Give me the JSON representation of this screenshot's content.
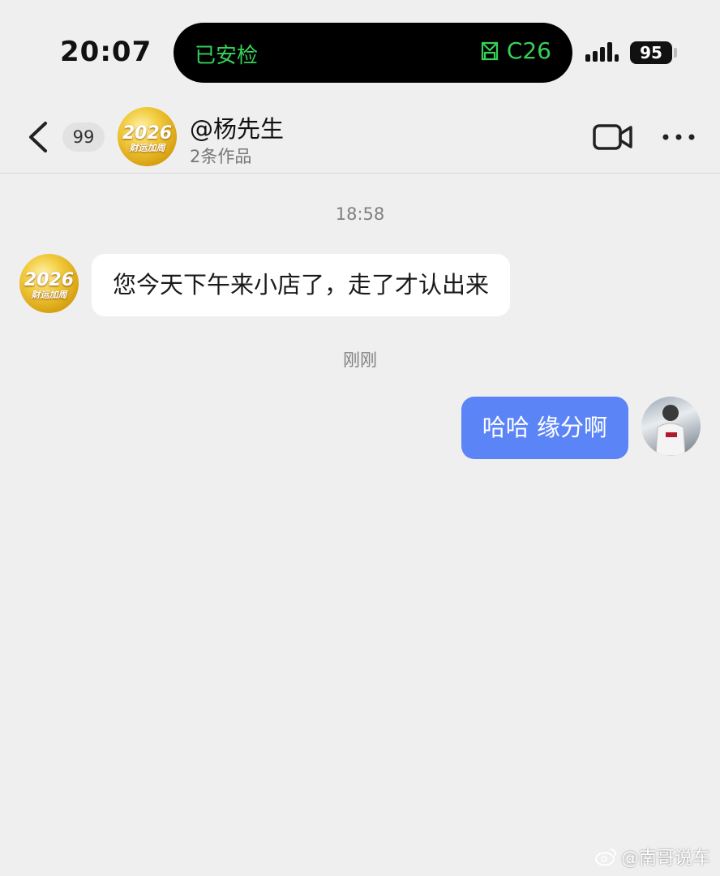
{
  "status_bar": {
    "time": "20:07",
    "island_left": "已安检",
    "island_right": "C26",
    "battery": "95",
    "accent_color": "#35d15a"
  },
  "header": {
    "unread_count": "99",
    "contact_name": "@杨先生",
    "contact_subtitle": "2条作品",
    "avatar_logo_text": "2026",
    "avatar_logo_subtext": "财运加周"
  },
  "chat": {
    "timestamps": [
      "18:58",
      "刚刚"
    ],
    "incoming_message": "您今天下午来小店了，走了才认出来",
    "outgoing_message": "哈哈  缘分啊",
    "outgoing_bubble_color": "#5b84f7"
  },
  "watermark": "@南哥说车"
}
